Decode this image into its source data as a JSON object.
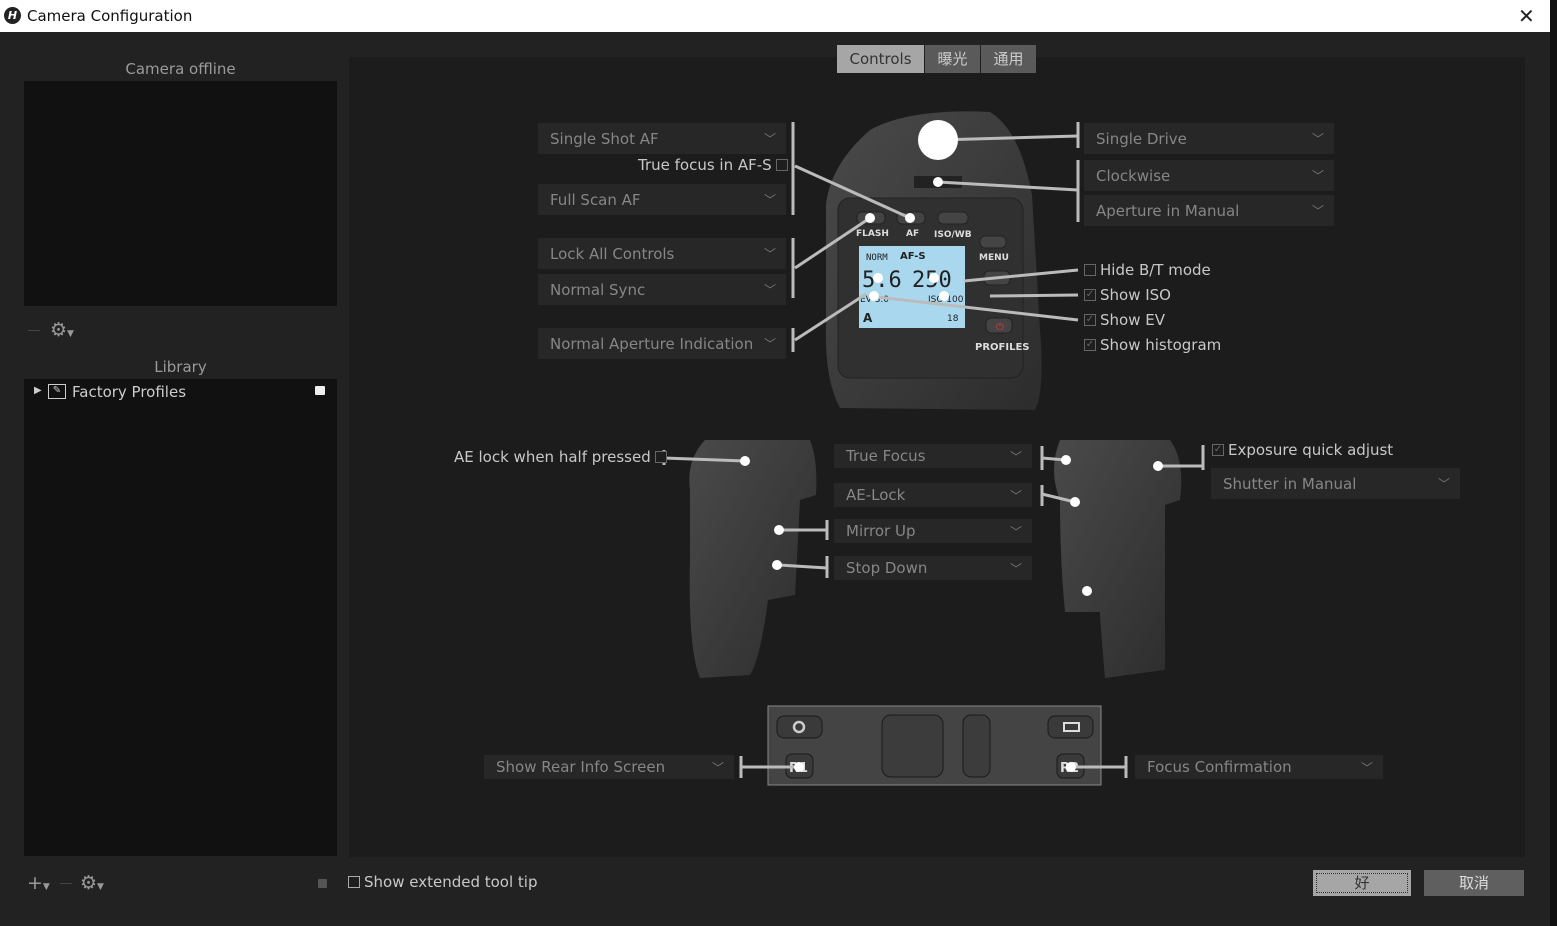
{
  "window": {
    "title": "Camera Configuration",
    "close_icon": "close-icon"
  },
  "left": {
    "preview_title": "Camera offline",
    "library_title": "Library",
    "library_items": [
      {
        "label": "Factory Profiles",
        "locked": true
      }
    ],
    "show_extended_tooltip": {
      "label": "Show extended tool tip",
      "checked": false
    }
  },
  "tabs": [
    {
      "label": "Controls",
      "active": true
    },
    {
      "label": "曝光",
      "active": false
    },
    {
      "label": "通用",
      "active": false
    }
  ],
  "controls": {
    "af_mode": "Single Shot AF",
    "true_focus_afs": {
      "label": "True focus in AF-S",
      "checked": false
    },
    "af_scan": "Full Scan AF",
    "lock": "Lock All Controls",
    "flash_sync": "Normal Sync",
    "aperture_indication": "Normal Aperture Indication",
    "drive": "Single Drive",
    "wheel_direction": "Clockwise",
    "wheel_function": "Aperture in Manual",
    "hide_bt": {
      "label": "Hide B/T mode",
      "checked": false
    },
    "show_iso": {
      "label": "Show ISO",
      "checked": true
    },
    "show_ev": {
      "label": "Show EV",
      "checked": true
    },
    "show_histogram": {
      "label": "Show histogram",
      "checked": true
    },
    "ae_lock_half": {
      "label": "AE lock when half pressed",
      "checked": false
    },
    "grip_buttons": [
      "True Focus",
      "AE-Lock",
      "Mirror Up",
      "Stop Down"
    ],
    "exposure_quick_adjust": {
      "label": "Exposure quick adjust",
      "checked": true
    },
    "rear_wheel": "Shutter in Manual",
    "r1": "Show Rear Info Screen",
    "r2": "Focus Confirmation"
  },
  "lcd": {
    "flash": "NORM",
    "af": "AF-S",
    "aperture": "5.6",
    "shutter": "250",
    "ev": "EV 3.0",
    "iso": "ISO 100",
    "frames": "18",
    "mode": "A"
  },
  "camera_labels": {
    "flash": "FLASH",
    "af": "AF",
    "isowb": "ISO/WB",
    "menu": "MENU",
    "profiles": "PROFILES",
    "r1": "R1",
    "r2": "R2"
  },
  "dialog": {
    "ok": "好",
    "cancel": "取消"
  }
}
